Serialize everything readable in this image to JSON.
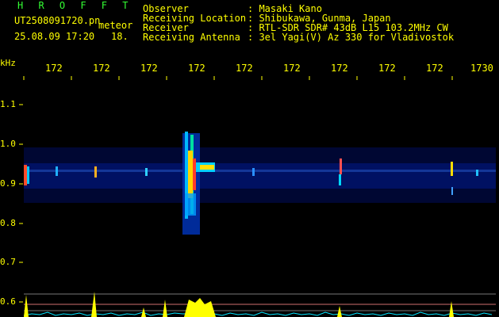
{
  "header": {
    "title": "H R O F F T",
    "filename": "UT2508091720.pn",
    "mode": "meteor",
    "datetime": "25.08.09 17:20",
    "count": "18.",
    "fields": [
      {
        "label": "Observer",
        "value": ": Masaki Kano"
      },
      {
        "label": "Receiving Location",
        "value": ": Shibukawa, Gunma, Japan"
      },
      {
        "label": "Receiver",
        "value": ": RTL-SDR SDR# 43dB L15 103.2MHz CW"
      },
      {
        "label": "Receiving Antenna",
        "value": ": 3el Yagi(V) Az 330 for Vladivostok"
      }
    ]
  },
  "axis": {
    "unit": "kHz",
    "x_ticks": [
      "172",
      "172",
      "172",
      "172",
      "172",
      "172",
      "172",
      "172",
      "172",
      "1730"
    ],
    "y_ticks": [
      "1.1",
      "1.0",
      "0.9",
      "0.8",
      "0.7",
      "0.6"
    ]
  },
  "colors": {
    "label": "#ffff00",
    "title": "#33ff33",
    "background": "#000000"
  }
}
